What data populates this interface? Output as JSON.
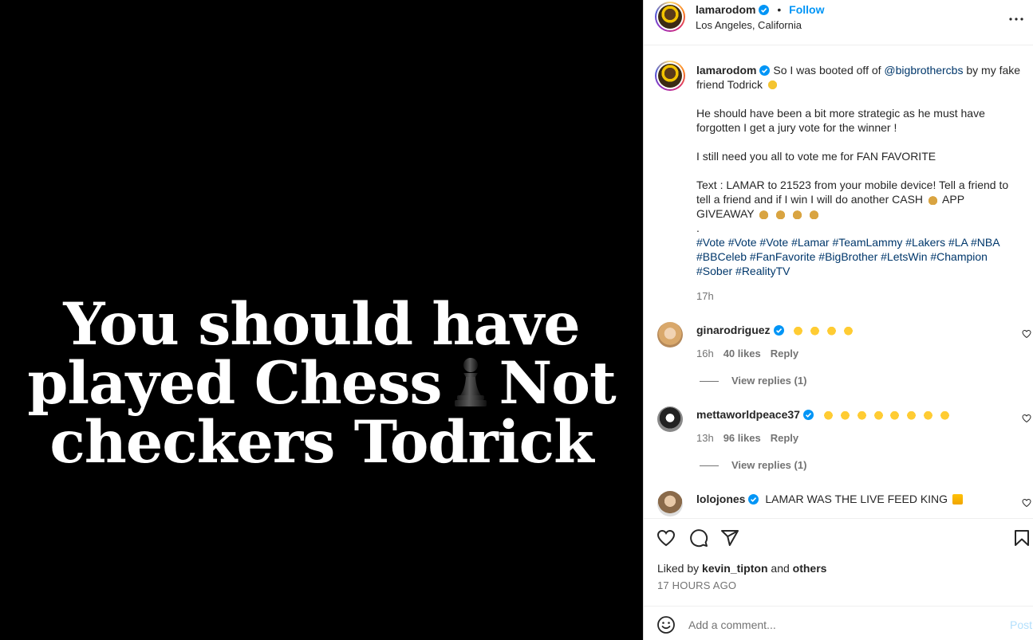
{
  "media": {
    "line1": "You should have",
    "line2a": "played Chess",
    "line2b": "Not",
    "line3": "checkers Todrick"
  },
  "header": {
    "username": "lamarodom",
    "separator": "•",
    "follow_label": "Follow",
    "location": "Los Angeles, California"
  },
  "caption": {
    "username": "lamarodom",
    "text1": "So I was booted off of",
    "mention": "@bigbrothercbs",
    "text2": "by my fake friend Todrick",
    "para2": "He should have been a bit more strategic as he must have forgotten I get a jury vote for the winner !",
    "para3": "I still need you all to vote me for FAN FAVORITE",
    "para4a": "Text : LAMAR to 21523 from your mobile device! Tell a friend to tell a friend and if I win I will do another CASH",
    "para4b": "APP GIVEAWAY",
    "dot": ".",
    "hashtags": "#Vote #Vote #Vote #Lamar #TeamLammy #Lakers #LA #NBA #BBCeleb #FanFavorite #BigBrother #LetsWin #Champion #Sober #RealityTV",
    "time": "17h"
  },
  "comments": [
    {
      "username": "ginarodriguez",
      "text": "",
      "time": "16h",
      "likes": "40 likes",
      "reply": "Reply",
      "view_replies": "View replies (1)"
    },
    {
      "username": "mettaworldpeace37",
      "text": "",
      "time": "13h",
      "likes": "96 likes",
      "reply": "Reply",
      "view_replies": "View replies (1)"
    },
    {
      "username": "lolojones",
      "text": "LAMAR WAS THE LIVE FEED KING"
    }
  ],
  "footer": {
    "liked_by_prefix": "Liked by",
    "liked_by_user": "kevin_tipton",
    "liked_by_and": "and",
    "liked_by_others": "others",
    "time_ago": "17 HOURS AGO",
    "comment_placeholder": "Add a comment...",
    "post_label": "Post"
  },
  "icons": {
    "more": "more-horizontal-icon",
    "like": "heart-icon",
    "comment": "comment-icon",
    "share": "paper-plane-icon",
    "save": "bookmark-icon",
    "emoji": "smiley-icon",
    "verified": "verified-badge-icon",
    "pawn": "chess-pawn-icon"
  },
  "colors": {
    "accent": "#0095f6",
    "link": "#00376b",
    "muted": "#737373",
    "post_disabled": "#b2dffc"
  }
}
